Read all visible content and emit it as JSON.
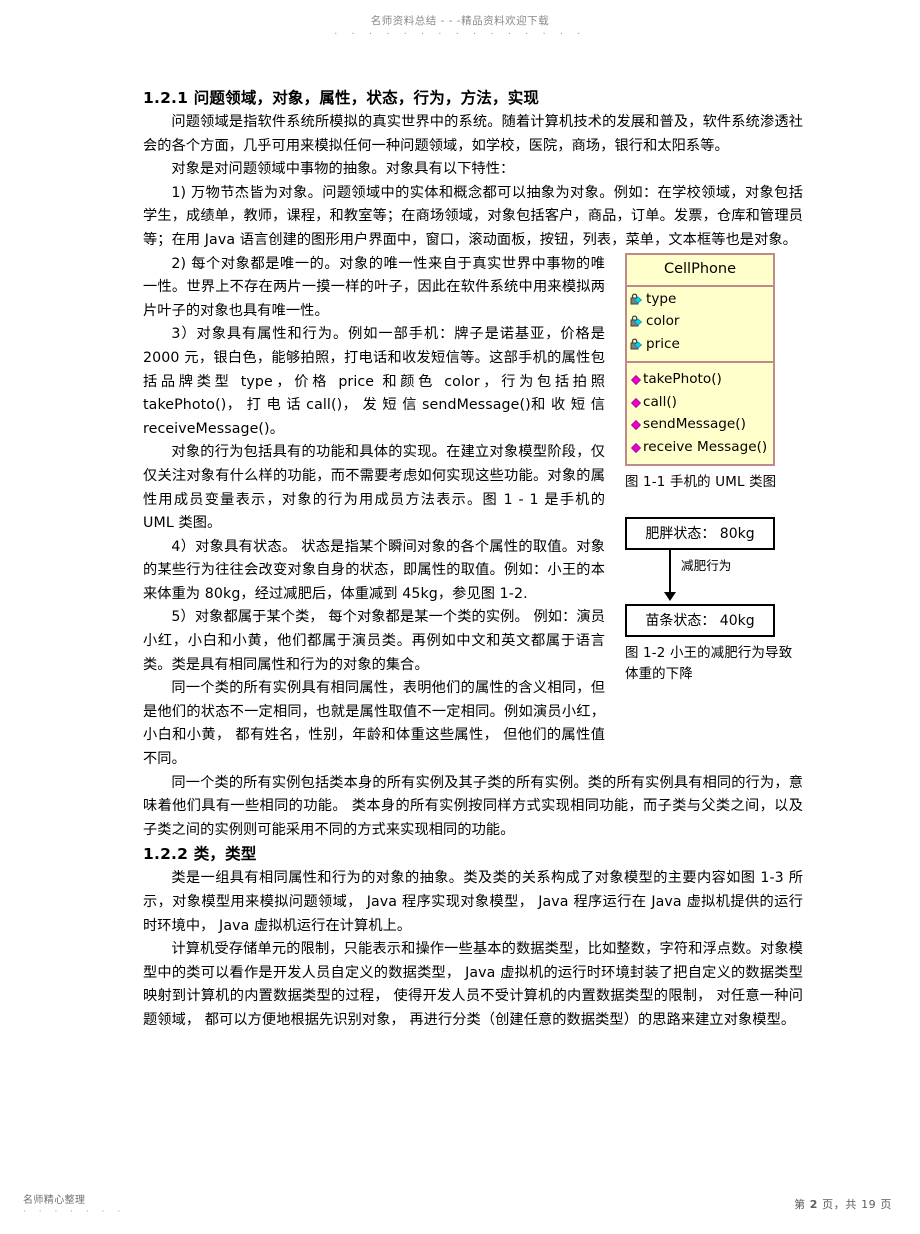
{
  "header": {
    "watermark": "名师资料总结 - - -精品资料欢迎下载",
    "dots": "· · · · · · · · · · · · · · ·"
  },
  "sections": [
    {
      "heading": "1.2.1  问题领域，对象，属性，状态，行为，方法，实现",
      "paragraphs": [
        "问题领域是指软件系统所模拟的真实世界中的系统。随着计算机技术的发展和普及，软件系统渗透社会的各个方面，几乎可用来模拟任何一种问题领域，如学校，医院，商场，银行和太阳系等。",
        "对象是对问题领域中事物的抽象。对象具有以下特性：",
        "1)  万物节杰皆为对象。问题领域中的实体和概念都可以抽象为对象。例如：在学校领域，对象包括学生，成绩单，教师，课程，和教室等；在商场领域，对象包括客户，商品，订单。发票，仓库和管理员等；在用        Java 语言创建的图形用户界面中，窗口，滚动面板，按钮，列表，菜单，文本框等也是对象。",
        "2)  每个对象都是唯一的。对象的唯一性来自于真实世界中事物的唯一性。世界上不存在两片一摸一样的叶子，因此在软件系统中用来模拟两片叶子的对象也具有唯一性。",
        "3）对象具有属性和行为。例如一部手机：牌子是诺基亚，价格是 2000 元，银白色，能够拍照，打电话和收发短信等。这部手机的属性包括品牌类型    type，价格   price 和颜色   color，行为包括拍照 takePhoto()， 打 电 话  call()， 发 短 信  sendMessage()和 收 短 信 receiveMessage()。",
        "对象的行为包括具有的功能和具体的实现。在建立对象模型阶段，仅仅关注对象有什么样的功能，而不需要考虑如何实现这些功能。对象的属性用成员变量表示，对象的行为用成员方法表示。图 1 - 1 是手机的  UML  类图。",
        "4）对象具有状态。  状态是指某个瞬间对象的各个属性的取值。对象的某些行为往往会改变对象自身的状态，即属性的取值。例如：小王的本来体重为    80kg，经过减肥后，体重减到    45kg，参见图 1-2.",
        "5）对象都属于某个类，  每个对象都是某一个类的实例。    例如：演员小红，小白和小黄，他们都属于演员类。再例如中文和英文都属于语言类。类是具有相同属性和行为的对象的集合。",
        "同一个类的所有实例具有相同属性，表明他们的属性的含义相同，但是他们的状态不一定相同，也就是属性取值不一定相同。例如演员小红，  小白和小黄，  都有姓名，性别，年龄和体重这些属性，  但他们的属性值不同。",
        "同一个类的所有实例包括类本身的所有实例及其子类的所有实例。类的所有实例具有相同的行为，意味着他们具有一些相同的功能。  类本身的所有实例按同样方式实现相同功能，而子类与父类之间，以及子类之间的实例则可能采用不同的方式来实现相同的功能。"
      ]
    },
    {
      "heading": "1.2.2  类，类型",
      "paragraphs": [
        "类是一组具有相同属性和行为的对象的抽象。类及类的关系构成了对象模型的主要内容如图  1-3 所示，对象模型用来模拟问题领域，   Java 程序实现对象模型，  Java 程序运行在  Java 虚拟机提供的运行时环境中，    Java 虚拟机运行在计算机上。",
        "计算机受存储单元的限制，只能表示和操作一些基本的数据类型，比如整数，字符和浮点数。对象模型中的类可以看作是开发人员自定义的数据类型，      Java 虚拟机的运行时环境封装了把自定义的数据类型映射到计算机的内置数据类型的过程，     使得开发人员不受计算机的内置数据类型的限制，  对任意一种问题领域，  都可以方便地根据先识别对象，  再进行分类（创建任意的数据类型）的思路来建立对象模型。"
      ]
    }
  ],
  "figures": {
    "uml": {
      "class_name": "CellPhone",
      "attributes": [
        "type",
        "color",
        "price"
      ],
      "methods": [
        "takePhoto()",
        "call()",
        "sendMessage()",
        "receive Message()"
      ],
      "caption": "图  1-1  手机的  UML  类图",
      "border_color": "#c08a8a",
      "fill_color": "#ffffcc",
      "attribute_icon": "lock-icon",
      "method_icon": "magenta-diamond-icon"
    },
    "state": {
      "from_state": "肥胖状态：  80kg",
      "transition": "减肥行为",
      "to_state": "苗条状态：  40kg",
      "caption": "图  1-2 小王的减肥行为导致体重的下降"
    }
  },
  "footer": {
    "left_text": "名师精心整理",
    "left_dots": "· · · · · · ·",
    "page_prefix": "第",
    "page_number": "2",
    "page_mid": "页，共",
    "page_total": "19",
    "page_suffix": "页"
  }
}
